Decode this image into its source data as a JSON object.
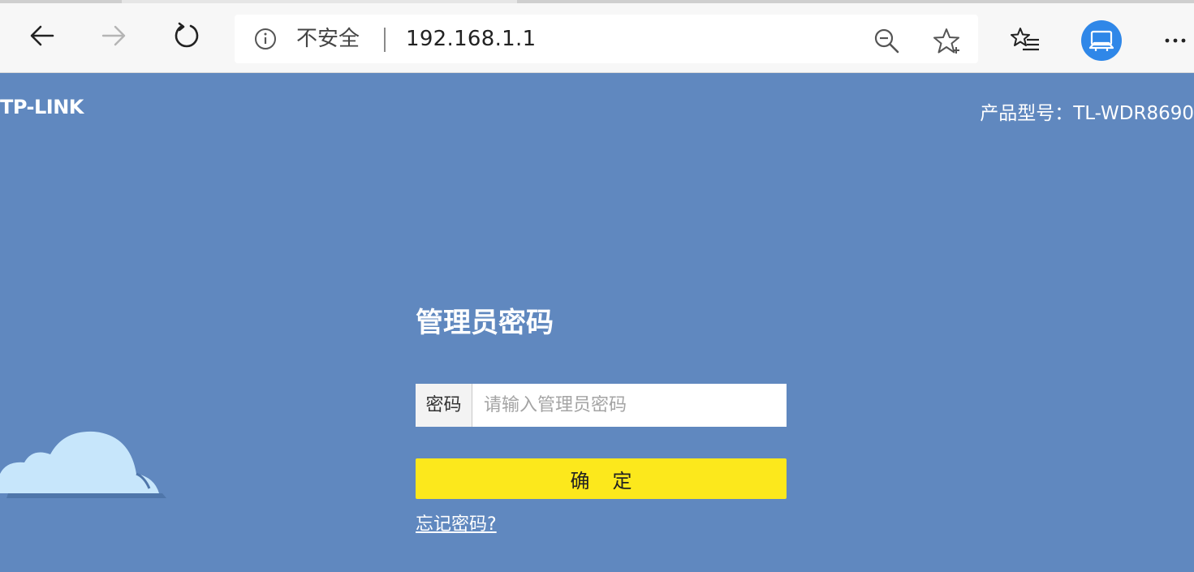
{
  "browser": {
    "security_text": "不安全",
    "url": "192.168.1.1",
    "icons": {
      "back": "arrow-left-icon",
      "forward": "arrow-right-icon",
      "refresh": "refresh-icon",
      "info": "info-circle-icon",
      "zoom": "zoom-out-icon",
      "favorite": "star-add-icon",
      "favorites_list": "favorites-list-icon",
      "profile": "profile-avatar-icon",
      "more": "more-dots-icon"
    },
    "colors": {
      "toolbar_bg": "#f7f7f7",
      "avatar": "#2f87e8"
    }
  },
  "router": {
    "brand": "TP-LINK",
    "model_label": "产品型号：TL-WDR8690",
    "login": {
      "title": "管理员密码",
      "password_label": "密码",
      "password_placeholder": "请输入管理员密码",
      "password_value": "",
      "confirm_label": "确定",
      "forgot_link": "忘记密码?"
    },
    "colors": {
      "page_bg": "#6088bf",
      "button_bg": "#fce81c",
      "cloud": "#c7e6fb"
    }
  }
}
